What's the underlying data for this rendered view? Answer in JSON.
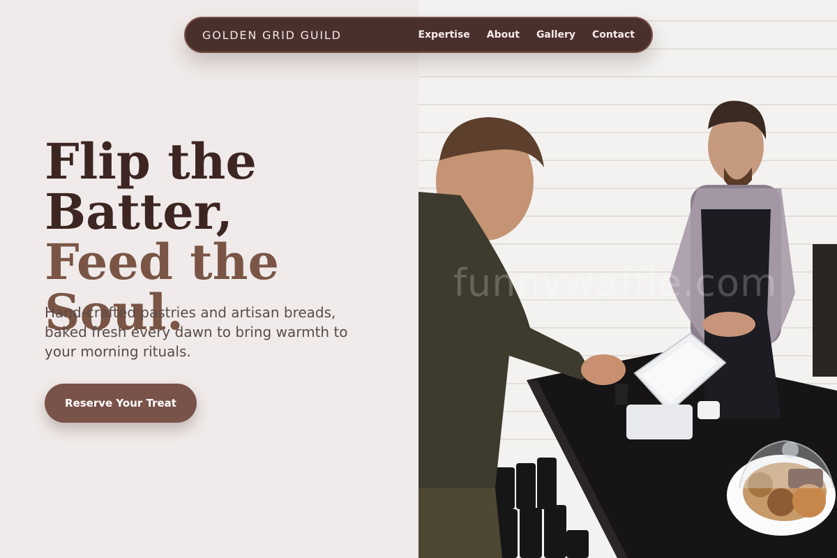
{
  "nav": {
    "brand": "GOLDEN GRID GUILD",
    "links": [
      "Expertise",
      "About",
      "Gallery",
      "Contact"
    ]
  },
  "hero": {
    "title_line1": "Flip the",
    "title_line2": "Batter,",
    "title_line3": "Feed the Soul.",
    "subtitle": "Hand-crafted pastries and artisan breads, baked fresh every dawn to bring warmth to your morning rituals.",
    "cta": "Reserve Your Treat"
  },
  "photo": {
    "watermark": "funnywaffle.com"
  },
  "colors": {
    "nav_bg": "#4a302d",
    "title_dark": "#3d2622",
    "title_accent": "#7a5545",
    "cta_bg": "#795249",
    "page_bg": "#f0ebea"
  }
}
